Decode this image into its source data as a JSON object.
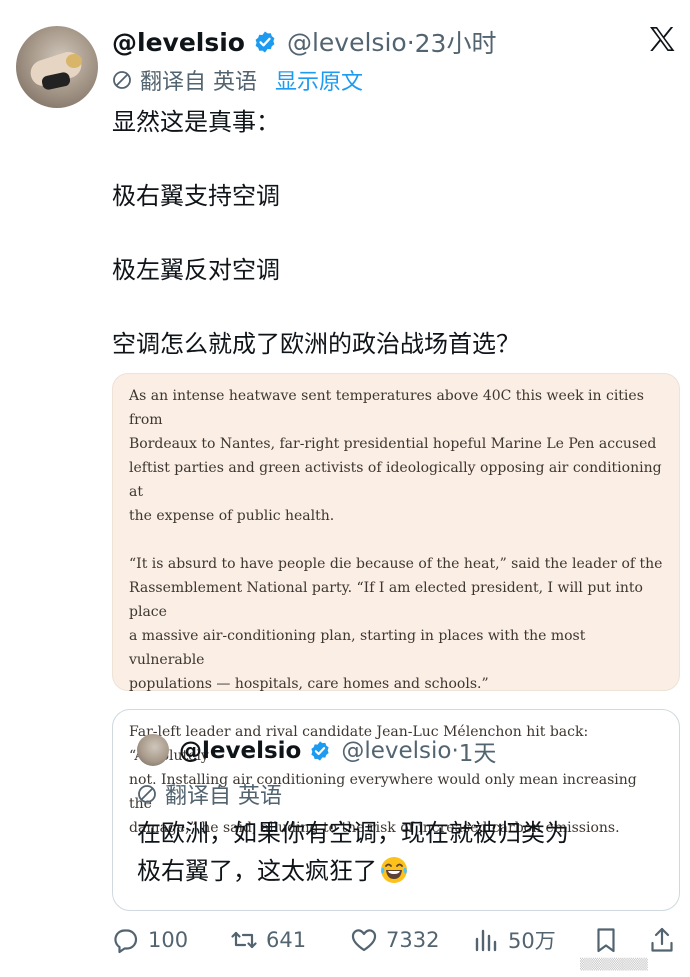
{
  "author": {
    "display_name": "@levelsio",
    "handle": "@levelsio",
    "separator": "·",
    "time": "23小时"
  },
  "translation": {
    "label": "翻译自 英语",
    "show_original": "显示原文"
  },
  "tweet": {
    "lines": [
      "显然这是真事：",
      "极右翼支持空调",
      "极左翼反对空调",
      "空调怎么就成了欧洲的政治战场首选？"
    ]
  },
  "article_image": {
    "paragraphs": [
      {
        "lines": [
          "As an intense heatwave sent temperatures above 40C this week in cities from",
          "Bordeaux to Nantes, far-right presidential hopeful Marine Le Pen accused",
          "leftist parties and green activists of ideologically opposing air conditioning at",
          "the expense of public health."
        ]
      },
      {
        "lines": [
          "“It is absurd to have people die because of the heat,” said the leader of the",
          "Rassemblement National party. “If I am elected president, I will put into place",
          "a massive air-conditioning plan, starting in places with the most vulnerable",
          "populations — hospitals, care homes and schools.”"
        ]
      },
      {
        "lines": [
          "Far-left leader and rival candidate Jean-Luc Mélenchon hit back: “Absolutely",
          "not. Installing air conditioning everywhere would only mean increasing the",
          "damage,” he said, alluding to the risk of increased carbon emissions."
        ]
      }
    ]
  },
  "quoted_tweet": {
    "display_name": "@levelsio",
    "handle": "@levelsio",
    "separator": "·",
    "time": "1天",
    "translation_label": "翻译自 英语",
    "text_line_1": "在欧洲，如果你有空调，现在就被归类为",
    "text_line_2": "极右翼了，这太疯狂了",
    "emoji_icon": "laughing-tears-emoji"
  },
  "actions": {
    "replies": "100",
    "reposts": "641",
    "likes": "7332",
    "views": "50万"
  },
  "colors": {
    "accent": "#1d9bf0",
    "secondary_text": "#536471",
    "article_bg": "#faeee5"
  }
}
